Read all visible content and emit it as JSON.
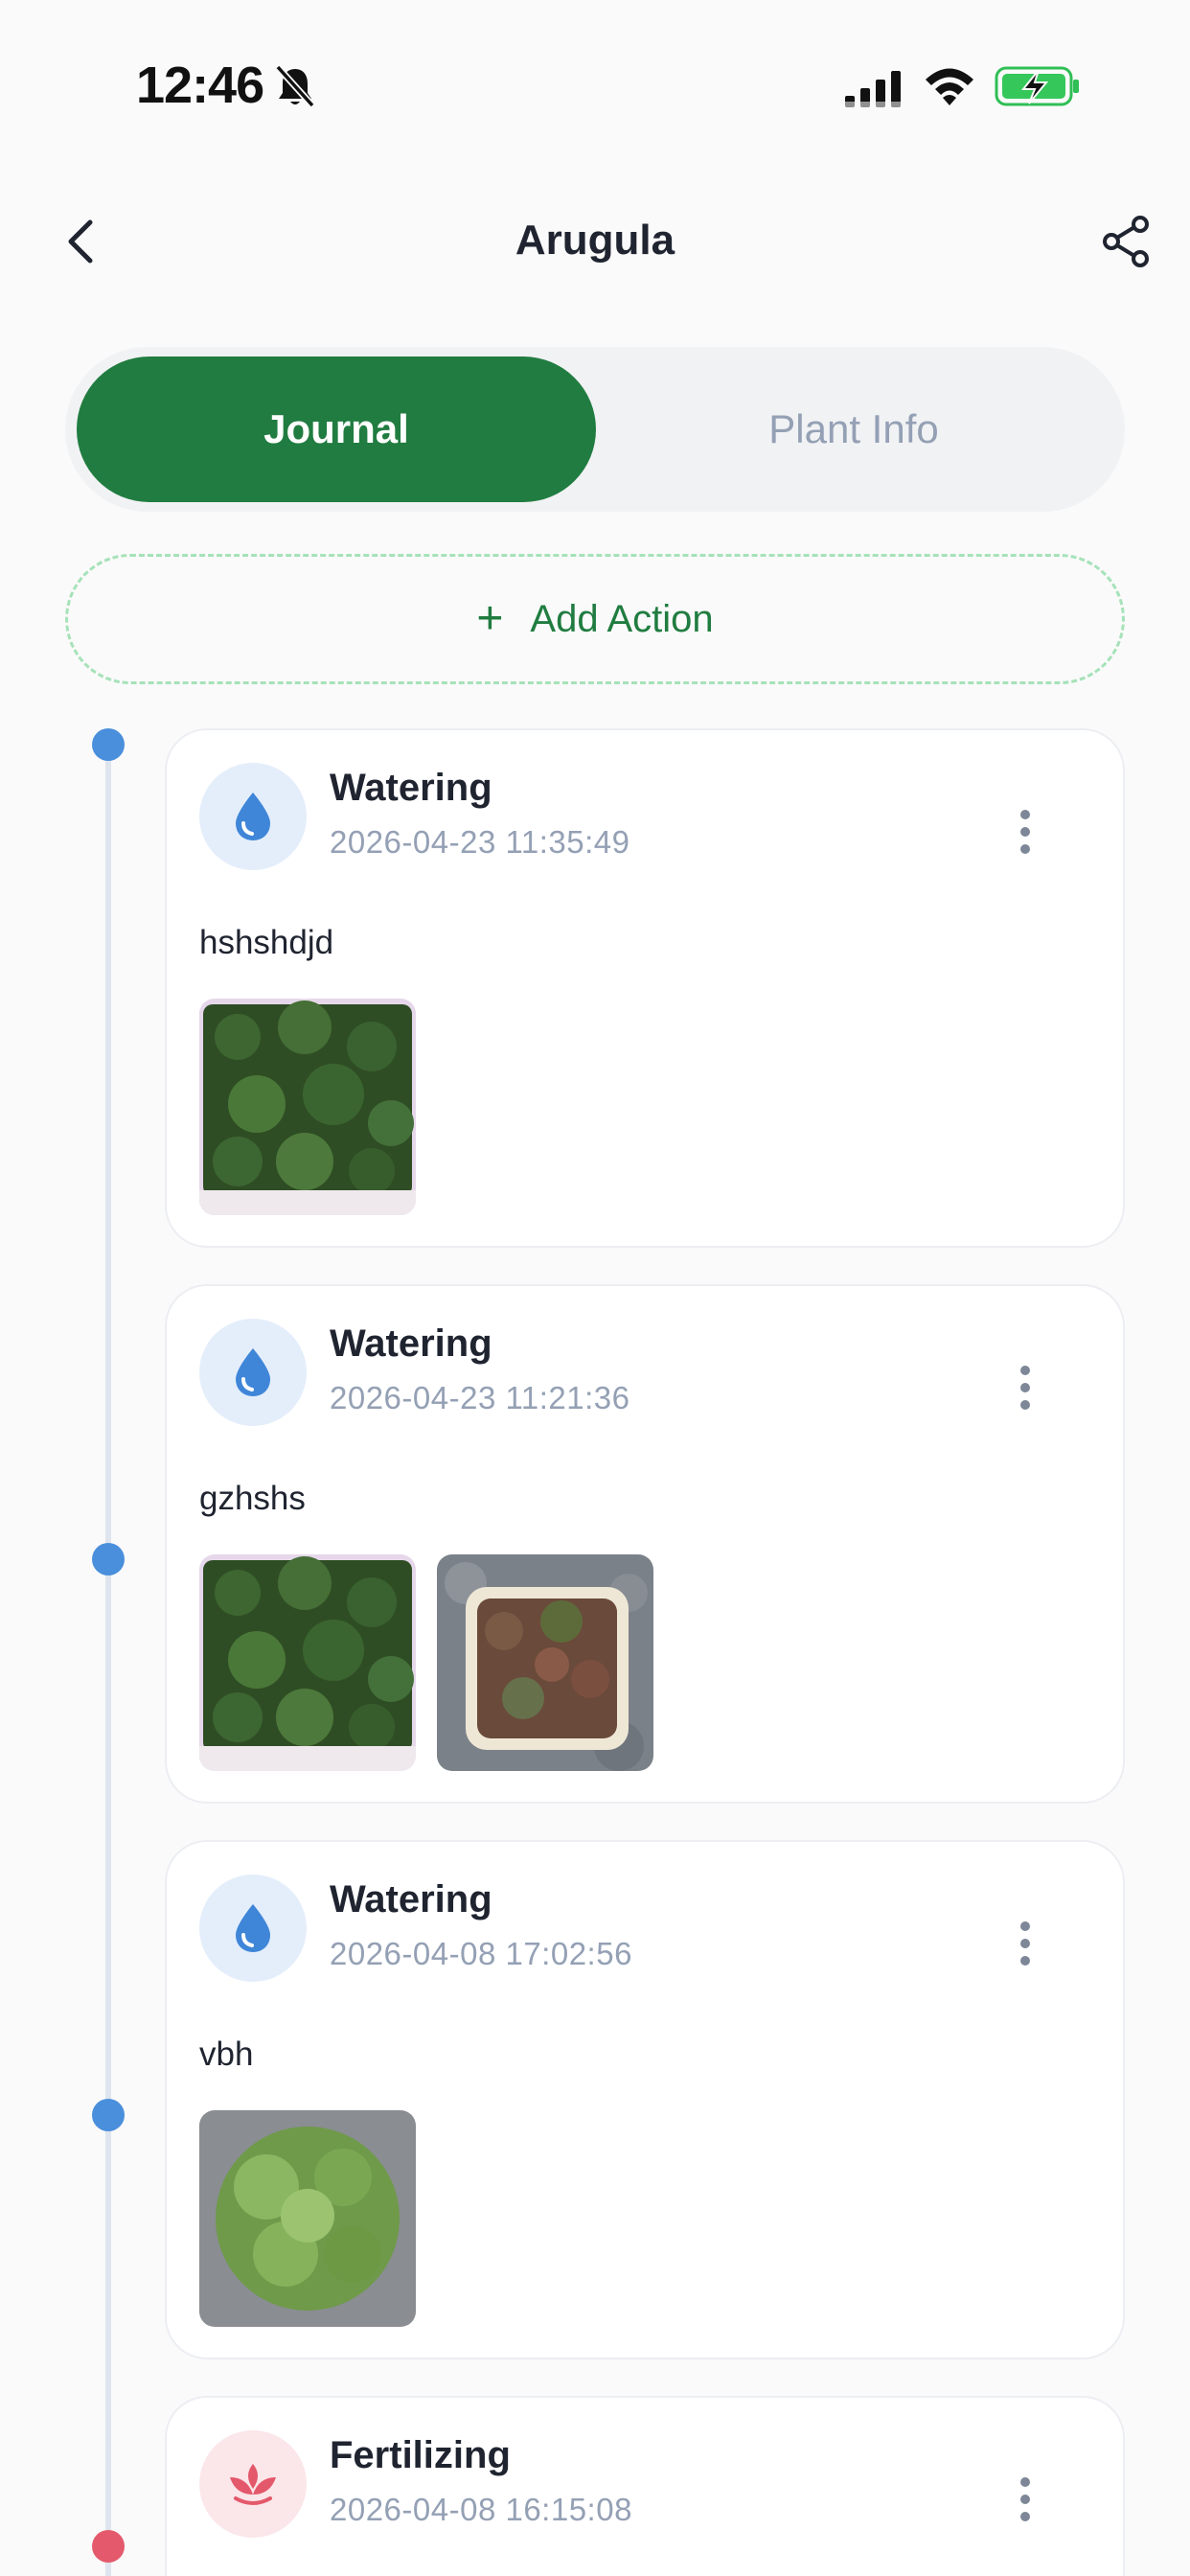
{
  "status_bar": {
    "time": "12:46"
  },
  "header": {
    "title": "Arugula"
  },
  "tabs": [
    {
      "label": "Journal",
      "active": true
    },
    {
      "label": "Plant Info",
      "active": false
    }
  ],
  "add_action": {
    "icon": "plus-icon",
    "label": "Add Action"
  },
  "entries": [
    {
      "type": "Watering",
      "icon": "water-drop-icon",
      "timestamp": "2026-04-23 11:35:49",
      "note": "hshshdjd",
      "photo_count": 1
    },
    {
      "type": "Watering",
      "icon": "water-drop-icon",
      "timestamp": "2026-04-23 11:21:36",
      "note": "gzhshs",
      "photo_count": 2
    },
    {
      "type": "Watering",
      "icon": "water-drop-icon",
      "timestamp": "2026-04-08 17:02:56",
      "note": "vbh",
      "photo_count": 1
    },
    {
      "type": "Fertilizing",
      "icon": "fertilizer-sprout-icon",
      "timestamp": "2026-04-08 16:15:08"
    }
  ],
  "colors": {
    "accent_green": "#207c40",
    "watering_blue": "#4a8fdc",
    "fertilizing_red": "#e45a6c",
    "muted_text": "#94a0b4"
  }
}
